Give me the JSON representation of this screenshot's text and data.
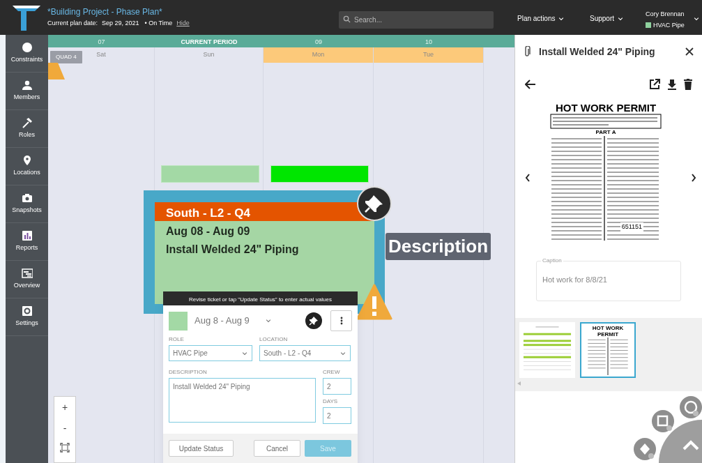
{
  "header": {
    "title": "*Building Project - Phase Plan*",
    "plan_date_label": "Current plan date:",
    "plan_date": "Sep 29, 2021",
    "status": "• On Time",
    "hide_link": "Hide",
    "search": {
      "placeholder": "Search..."
    },
    "menus": [
      "Plan actions",
      "Support"
    ],
    "user": {
      "name": "Cory Brennan",
      "role": "HVAC Pipe",
      "color": "#8fd19e"
    }
  },
  "sidebar": {
    "items": [
      {
        "label": "Constraints"
      },
      {
        "label": "Members"
      },
      {
        "label": "Roles"
      },
      {
        "label": "Locations"
      },
      {
        "label": "Snapshots"
      },
      {
        "label": "Reports"
      },
      {
        "label": "Overview"
      },
      {
        "label": "Settings"
      }
    ]
  },
  "calendar": {
    "period_row": [
      {
        "label": "07",
        "current": false
      },
      {
        "label": "CURRENT PERIOD",
        "current": true
      },
      {
        "label": "09",
        "current": false
      },
      {
        "label": "10",
        "current": false
      }
    ],
    "days": [
      {
        "label": "Sat",
        "highlighted": false
      },
      {
        "label": "Sun",
        "highlighted": false
      },
      {
        "label": "Mon",
        "highlighted": true
      },
      {
        "label": "Tue",
        "highlighted": true
      }
    ],
    "quad_badge": "QUAD 4",
    "bars": [
      {
        "color": "#a3d9a5"
      },
      {
        "color": "#00e600"
      }
    ],
    "ticket": {
      "location": "South - L2 - Q4",
      "dates": "Aug 08 - Aug 09",
      "description": "Install Welded 24\" Piping",
      "selected": true
    },
    "overlay_label": "Description"
  },
  "editor": {
    "banner": "Revise ticket or tap \"Update Status\" to enter actual values",
    "color": "#a3d9a5",
    "dates": "Aug 8 - Aug 9",
    "role": {
      "label": "ROLE",
      "value": "HVAC Pipe"
    },
    "location": {
      "label": "LOCATION",
      "value": "South - L2 - Q4"
    },
    "description": {
      "label": "DESCRIPTION",
      "value": "Install Welded 24\" Piping"
    },
    "crew": {
      "label": "CREW",
      "value": "2"
    },
    "days": {
      "label": "DAYS",
      "value": "2"
    },
    "buttons": [
      {
        "label": "Update Status",
        "kind": "outline"
      },
      {
        "label": "Cancel",
        "kind": "outline"
      },
      {
        "label": "Save",
        "kind": "primary",
        "disabled": true
      }
    ]
  },
  "zoom_controls": [
    "+",
    "-"
  ],
  "attachment_panel": {
    "title": "Install Welded 24\" Piping",
    "document": {
      "title": "HOT WORK PERMIT",
      "section": "PART A",
      "number": "651151"
    },
    "caption": {
      "label": "Caption",
      "value": "Hot work for 8/8/21"
    },
    "thumbnails": [
      {
        "selected": false
      },
      {
        "selected": true,
        "title": "HOT WORK PERMIT"
      }
    ]
  }
}
